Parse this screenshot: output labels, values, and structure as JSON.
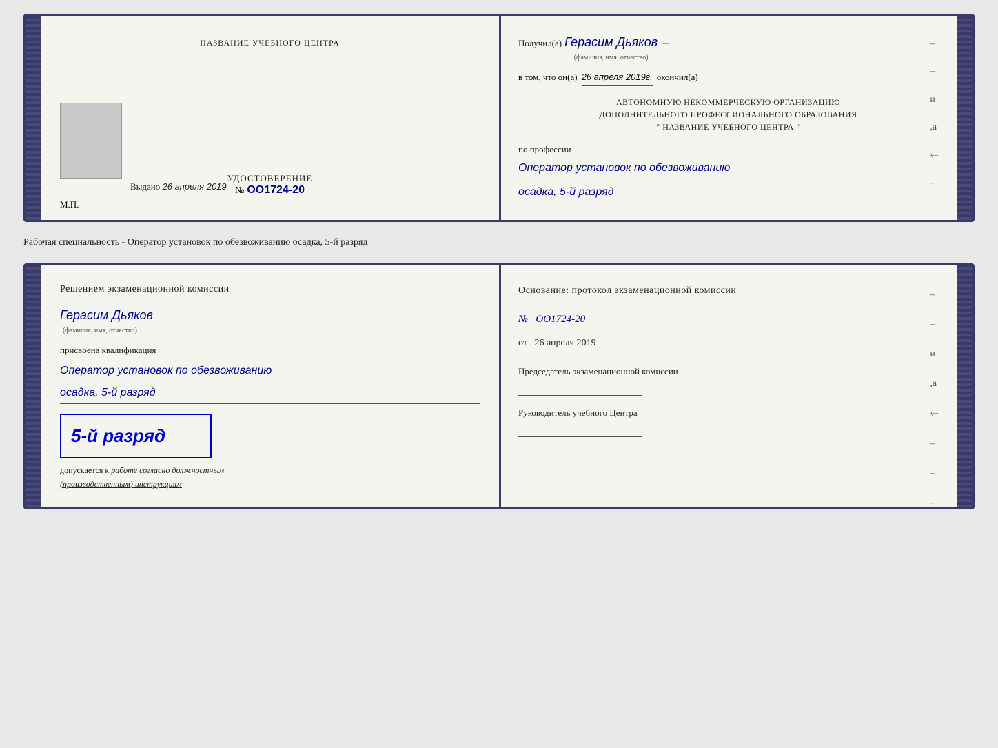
{
  "page": {
    "background": "#e8e8e8"
  },
  "card1": {
    "left": {
      "org_name_label": "НАЗВАНИЕ УЧЕБНОГО ЦЕНТРА",
      "cert_title": "УДОСТОВЕРЕНИЕ",
      "cert_number_prefix": "№",
      "cert_number": "OO1724-20",
      "issued_label": "Выдано",
      "issued_date": "26 апреля 2019",
      "mp_label": "М.П."
    },
    "right": {
      "recipient_label": "Получил(а)",
      "recipient_name": "Герасим Дьяков",
      "recipient_sub": "(фамилия, имя, отчество)",
      "date_label": "в том, что он(а)",
      "date_value": "26 апреля 2019г.",
      "date_ended": "окончил(а)",
      "org_line1": "АВТОНОМНУЮ НЕКОММЕРЧЕСКУЮ ОРГАНИЗАЦИЮ",
      "org_line2": "ДОПОЛНИТЕЛЬНОГО ПРОФЕССИОНАЛЬНОГО ОБРАЗОВАНИЯ",
      "org_line3": "\" НАЗВАНИЕ УЧЕБНОГО ЦЕНТРА \"",
      "profession_label": "по профессии",
      "profession_value": "Оператор установок по обезвоживанию",
      "qualification_value": "осадка, 5-й разряд"
    }
  },
  "specialty_text": "Рабочая специальность - Оператор установок по обезвоживанию осадка, 5-й разряд",
  "card2": {
    "left": {
      "decision_title": "Решением экзаменационной комиссии",
      "person_name": "Герасим Дьяков",
      "person_sub": "(фамилия, имя, отчество)",
      "assigned_label": "присвоена квалификация",
      "assigned_value": "Оператор установок по обезвоживанию",
      "assigned_value2": "осадка, 5-й разряд",
      "rank_text": "5-й разряд",
      "allowed_text_prefix": "допускается к",
      "allowed_underline": "работе согласно должностным",
      "allowed_text2": "(производственным) инструкциям"
    },
    "right": {
      "basis_title": "Основание: протокол экзаменационной комиссии",
      "protocol_prefix": "№",
      "protocol_number": "OO1724-20",
      "date_prefix": "от",
      "date_value": "26 апреля 2019",
      "chairman_label": "Председатель экзаменационной комиссии",
      "director_label": "Руководитель учебного Центра"
    }
  }
}
